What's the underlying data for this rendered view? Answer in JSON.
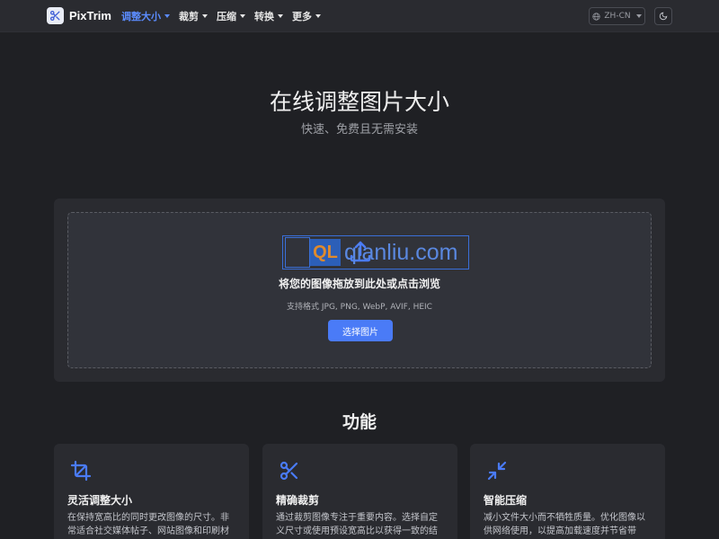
{
  "brand": {
    "name": "PixTrim"
  },
  "nav": {
    "items": [
      {
        "label": "调整大小",
        "active": true
      },
      {
        "label": "裁剪",
        "active": false
      },
      {
        "label": "压缩",
        "active": false
      },
      {
        "label": "转换",
        "active": false
      },
      {
        "label": "更多",
        "active": false
      }
    ],
    "language": "ZH-CN"
  },
  "hero": {
    "title": "在线调整图片大小",
    "subtitle": "快速、免费且无需安装"
  },
  "upload": {
    "title": "将您的图像拖放到此处或点击浏览",
    "formats": "支持格式 JPG, PNG, WebP, AVIF, HEIC",
    "button": "选择图片"
  },
  "watermark": {
    "logo": "QL",
    "text": "qianliu.com"
  },
  "features": {
    "title": "功能",
    "items": [
      {
        "icon": "crop-icon",
        "title": "灵活调整大小",
        "desc": "在保持宽高比的同时更改图像的尺寸。非常适合社交媒体帖子、网站图像和印刷材"
      },
      {
        "icon": "scissors-icon",
        "title": "精确裁剪",
        "desc": "通过裁剪图像专注于重要内容。选择自定义尺寸或使用预设宽高比以获得一致的结"
      },
      {
        "icon": "compress-icon",
        "title": "智能压缩",
        "desc": "减小文件大小而不牺牲质量。优化图像以供网络使用，以提高加载速度并节省带"
      }
    ]
  },
  "colors": {
    "accent": "#4a7bf7",
    "active_nav": "#5b8cff",
    "background": "#1f2024",
    "card": "#2a2b30"
  }
}
